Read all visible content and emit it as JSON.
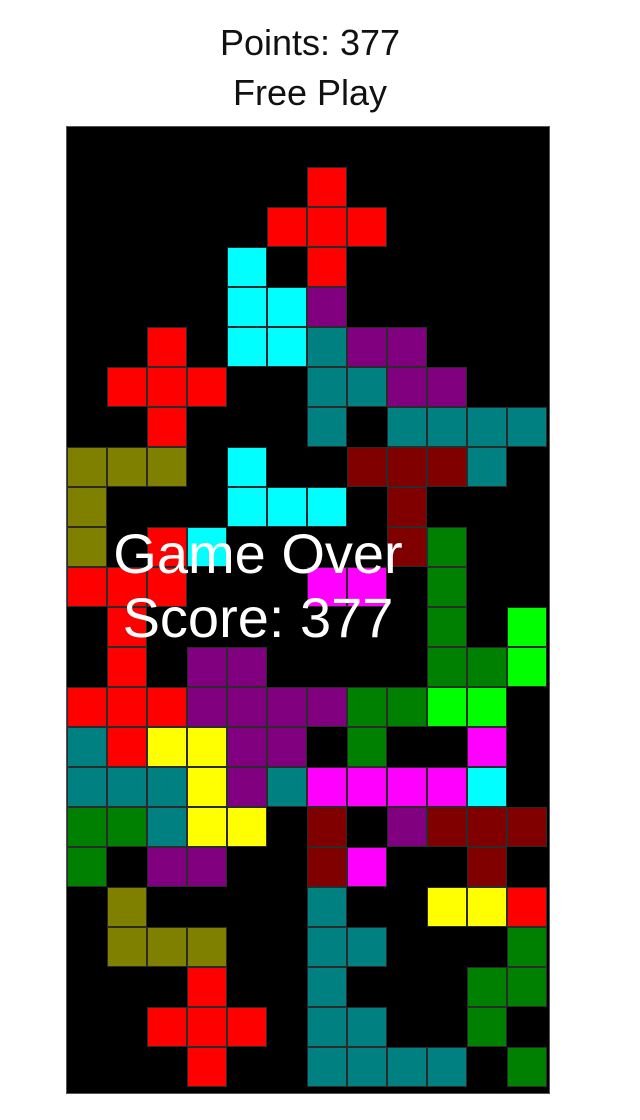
{
  "header": {
    "points_text": "Points: 377",
    "mode_text": "Free Play"
  },
  "overlay": {
    "title": "Game Over",
    "score_text": "Score: 377"
  },
  "board": {
    "cols": 12,
    "rows": 24,
    "palette": {
      "R": "#ff0000",
      "C": "#00ffff",
      "P": "#800080",
      "T": "#008080",
      "O": "#808000",
      "M": "#800000",
      "G": "#008000",
      "L": "#00ff00",
      "Y": "#ffff00",
      "K": "#ff00ff"
    },
    "grid": [
      "............",
      "......R.....",
      ".....RRR....",
      "....C.R.....",
      "....CCP.....",
      "..R.CCTPP...",
      ".RRR..TTPP..",
      "..R...T.TTTT",
      "OOO.C..MMMT.",
      "O...CCC.M...",
      "O.RC....MG..",
      "RRR...KK.G..",
      ".R.......G.L",
      ".R.PP....GGLL",
      "RRRPPPPGGLL.",
      "TRYYPP.G..K.",
      "TTTYPTKKKKC.",
      "GGTYY.M.PMMM",
      "G.PP..MK..M.",
      ".O....T..YYR",
      ".OOO..TT...G",
      "...R..T...GG",
      "..RRR.TT..G.",
      "...R..TTTT.G"
    ]
  }
}
